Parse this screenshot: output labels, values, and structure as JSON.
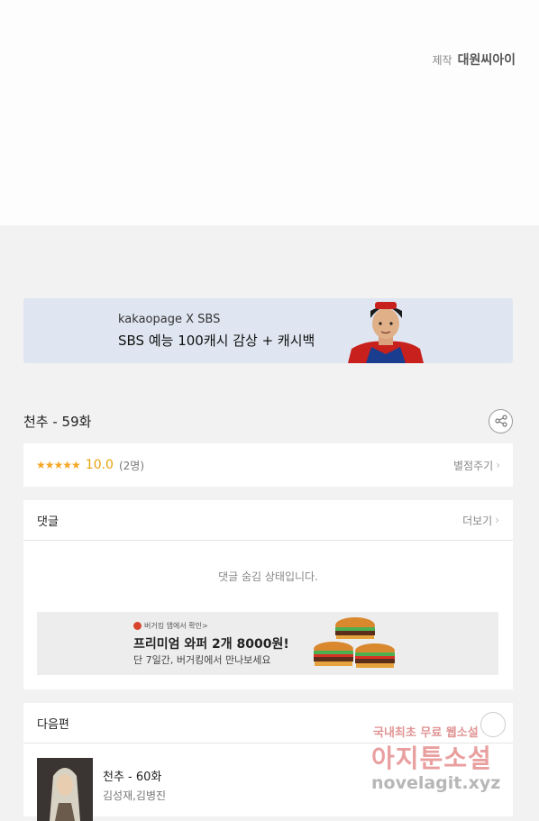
{
  "credit": {
    "label": "제작",
    "studio": "대원씨아이"
  },
  "banner": {
    "brand": "kakaopage X SBS",
    "headline": "SBS 예능 100캐시 감상 + 캐시백"
  },
  "episode": {
    "title": "천추 - 59화"
  },
  "rating": {
    "stars": "★★★★★",
    "score": "10.0",
    "count": "(2명)",
    "action": "별점주기"
  },
  "comments": {
    "heading": "댓글",
    "more": "더보기",
    "hidden_message": "댓글 숨김 상태입니다.",
    "ad": {
      "small": "버거킹 앱에서 확인>",
      "headline": "프리미엄 와퍼 2개 8000원!",
      "sub": "단 7일간, 버거킹에서 만나보세요"
    }
  },
  "next": {
    "heading": "다음편",
    "title": "천추 - 60화",
    "authors": "김성재,김병진"
  },
  "watermark": {
    "line1": "국내최초 무료 웹소설",
    "line2": "아지툰소설",
    "line3": "novelagit.xyz"
  },
  "colors": {
    "accent": "#e8a20b",
    "banner_bg": "#dfe6f1"
  }
}
